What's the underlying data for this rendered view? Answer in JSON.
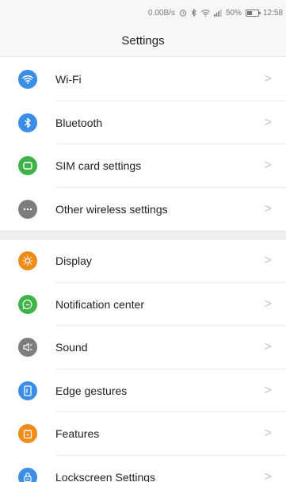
{
  "status_bar": {
    "speed": "0.00B/s",
    "battery_percent": "50%",
    "time": "12:58"
  },
  "title": "Settings",
  "groups": [
    {
      "items": [
        {
          "label": "Wi-Fi",
          "icon": "wifi-icon",
          "color": "#3a8ee6"
        },
        {
          "label": "Bluetooth",
          "icon": "bluetooth-icon",
          "color": "#3a8ee6"
        },
        {
          "label": "SIM card settings",
          "icon": "sim-card-icon",
          "color": "#3db34a"
        },
        {
          "label": "Other wireless settings",
          "icon": "more-icon",
          "color": "#7d7d7d"
        }
      ]
    },
    {
      "items": [
        {
          "label": "Display",
          "icon": "brightness-icon",
          "color": "#f08c1a"
        },
        {
          "label": "Notification center",
          "icon": "notification-icon",
          "color": "#3db34a"
        },
        {
          "label": "Sound",
          "icon": "speaker-icon",
          "color": "#7d7d7d"
        },
        {
          "label": "Edge gestures",
          "icon": "edge-gestures-icon",
          "color": "#3a8ee6"
        },
        {
          "label": "Features",
          "icon": "features-icon",
          "color": "#f08c1a"
        },
        {
          "label": "Lockscreen Settings",
          "icon": "lock-icon",
          "color": "#3a8ee6"
        }
      ]
    }
  ]
}
